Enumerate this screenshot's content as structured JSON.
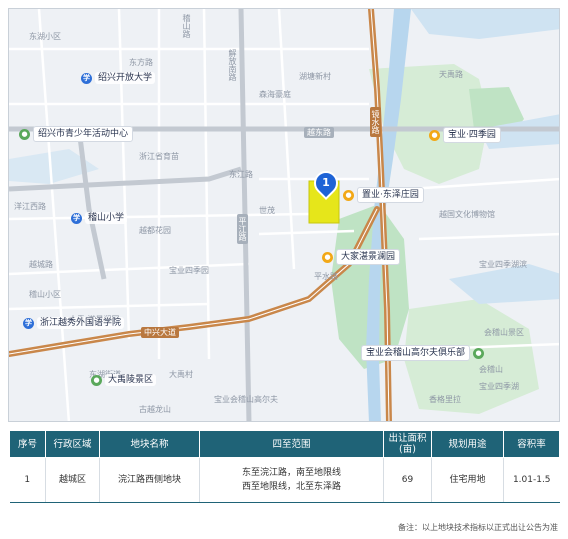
{
  "map": {
    "site_marker_number": "1",
    "pois": [
      {
        "id": "shaoxing-open-university",
        "text": "绍兴开放大学",
        "icon": "school"
      },
      {
        "id": "youth-activity-center",
        "text": "绍兴市青少年活动中心",
        "icon": "green"
      },
      {
        "id": "jishan-primary-school",
        "text": "稽山小学",
        "icon": "school"
      },
      {
        "id": "zhejiang-yuexiu-foreign-language",
        "text": "浙江越秀外国语学院",
        "icon": "school"
      },
      {
        "id": "dayu-mausoleum",
        "text": "大禹陵景区",
        "icon": "green"
      },
      {
        "id": "baoye-siji-garden",
        "text": "宝业·四季园",
        "icon": "orange"
      },
      {
        "id": "zhiye-dongze-garden",
        "text": "置业·东泽庄园",
        "icon": "orange"
      },
      {
        "id": "dajia-zhanjing-garden",
        "text": "大家湛景澜园",
        "icon": "orange"
      },
      {
        "id": "baoye-golf-club",
        "text": "宝业会稽山高尔夫俱乐部",
        "icon": "green"
      }
    ],
    "road_labels": [
      "镜水路",
      "中兴大道",
      "越东路",
      "平江路",
      "洋江西路",
      "东江路",
      "稽山路",
      "解放南路",
      "越城路"
    ],
    "minor_labels": [
      "东湖小区",
      "东方路",
      "浙江省育苗",
      "越都花园",
      "宝业四季园",
      "湖塘新村",
      "森海豪庭",
      "世茂",
      "稽山小区",
      "平水路",
      "大禹·湛景澜园",
      "天禹路",
      "宝业四季湖",
      "宝业会稽山高尔夫",
      "香格里拉",
      "会稽山",
      "宝业四季湖滨",
      "古越龙山",
      "大禹村",
      "东湖街道",
      "越国文化博物馆",
      "会稽山景区"
    ]
  },
  "table": {
    "headers": [
      "序号",
      "行政区域",
      "地块名称",
      "四至范围",
      "出让面积(亩)",
      "规划用途",
      "容积率"
    ],
    "rows": [
      {
        "no": "1",
        "district": "越城区",
        "name": "浣江路西侧地块",
        "bounds_line1": "东至浣江路，南至地限线",
        "bounds_line2": "西至地限线，北至东泽路",
        "area": "69",
        "use": "住宅用地",
        "far": "1.01-1.5"
      }
    ]
  },
  "footnote": "备注：以上地块技术指标以正式出让公告为准",
  "colors": {
    "header_bg": "#1f6377",
    "highway": "#c9874a",
    "site": "#e6e61a",
    "green_area": "#bfe3c4",
    "water": "#b7d6ee"
  }
}
